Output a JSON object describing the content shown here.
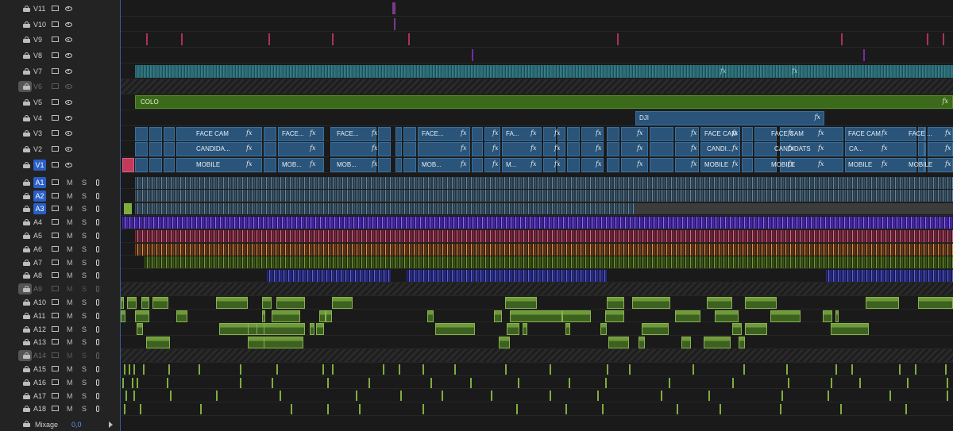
{
  "video_tracks": [
    {
      "name": "V11",
      "locked": false,
      "selected": false
    },
    {
      "name": "V10",
      "locked": false,
      "selected": false
    },
    {
      "name": "V9",
      "locked": false,
      "selected": false
    },
    {
      "name": "V8",
      "locked": false,
      "selected": false
    },
    {
      "name": "V7",
      "locked": false,
      "selected": false
    },
    {
      "name": "V6",
      "locked": true,
      "selected": false
    },
    {
      "name": "V5",
      "locked": false,
      "selected": false
    },
    {
      "name": "V4",
      "locked": false,
      "selected": false
    },
    {
      "name": "V3",
      "locked": false,
      "selected": false
    },
    {
      "name": "V2",
      "locked": false,
      "selected": false
    },
    {
      "name": "V1",
      "locked": false,
      "selected": true
    }
  ],
  "audio_tracks": [
    {
      "name": "A1",
      "locked": false,
      "selected": true
    },
    {
      "name": "A2",
      "locked": false,
      "selected": true
    },
    {
      "name": "A3",
      "locked": false,
      "selected": true
    },
    {
      "name": "A4",
      "locked": false,
      "selected": false
    },
    {
      "name": "A5",
      "locked": false,
      "selected": false
    },
    {
      "name": "A6",
      "locked": false,
      "selected": false
    },
    {
      "name": "A7",
      "locked": false,
      "selected": false
    },
    {
      "name": "A8",
      "locked": false,
      "selected": false
    },
    {
      "name": "A9",
      "locked": true,
      "selected": false
    },
    {
      "name": "A10",
      "locked": false,
      "selected": false
    },
    {
      "name": "A11",
      "locked": false,
      "selected": false
    },
    {
      "name": "A12",
      "locked": false,
      "selected": false
    },
    {
      "name": "A13",
      "locked": false,
      "selected": false
    },
    {
      "name": "A14",
      "locked": true,
      "selected": false
    },
    {
      "name": "A15",
      "locked": false,
      "selected": false
    },
    {
      "name": "A16",
      "locked": false,
      "selected": false
    },
    {
      "name": "A17",
      "locked": false,
      "selected": false
    },
    {
      "name": "A18",
      "locked": false,
      "selected": false
    }
  ],
  "audio_buttons": {
    "mute": "M",
    "solo": "S"
  },
  "mix": {
    "label": "Mixage",
    "value": "0,0"
  },
  "clips": {
    "v5_label": "COLO",
    "v4_label": "DJI",
    "fx": "fx",
    "v3": [
      "FACE CAM",
      "FACE...",
      "FACE...",
      "FACE...",
      "FA...",
      "FACE CAM",
      "FACE CAM",
      "FACE CAM",
      "FACE ..."
    ],
    "v2": [
      "CANDIDA...",
      "CANDI...",
      "CANDIDATS",
      "CA..."
    ],
    "v1": [
      "MOBILE",
      "MOB...",
      "MOB...",
      "MOB...",
      "M...",
      "MOBILE",
      "MOBILE",
      "MOBILE",
      "MOBILE"
    ]
  },
  "colors": {
    "video_clip": "#2a5479",
    "v5_clip": "#3b6a1a",
    "selected_track": "#2b5fc7",
    "audio_green": "#7fae3e"
  }
}
